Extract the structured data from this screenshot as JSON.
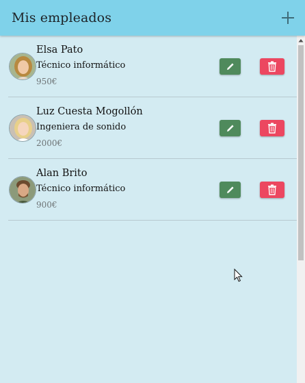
{
  "header": {
    "title": "Mis empleados",
    "add_icon": "plus-icon"
  },
  "employees": [
    {
      "name": "Elsa Pato",
      "role": "Técnico informático",
      "salary": "950€",
      "avatar": "woman-avatar"
    },
    {
      "name": "Luz Cuesta Mogollón",
      "role": "Ingeniera de sonido",
      "salary": "2000€",
      "avatar": "woman-avatar"
    },
    {
      "name": "Alan Brito",
      "role": "Técnico informático",
      "salary": "900€",
      "avatar": "man-avatar"
    }
  ],
  "icons": {
    "edit": "pencil-icon",
    "delete": "trash-icon"
  },
  "colors": {
    "header": "#7fd2ea",
    "background": "#d3ebf2",
    "edit_button": "#4f8a5c",
    "delete_button": "#ec4760"
  }
}
